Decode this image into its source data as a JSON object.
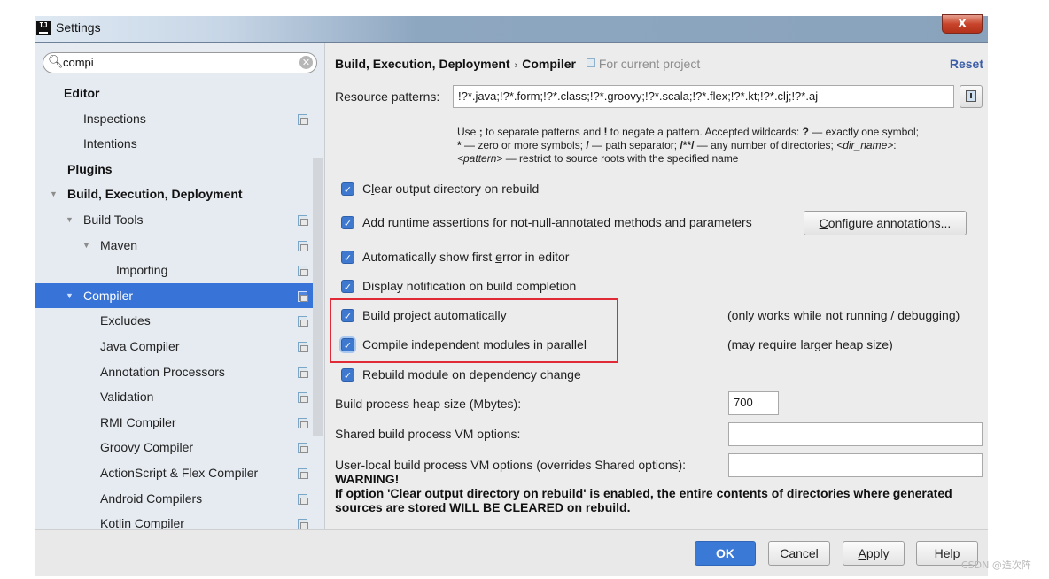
{
  "window": {
    "title": "Settings",
    "app_icon": "intellij-icon",
    "close_label": "x"
  },
  "search": {
    "value": "compi",
    "icon": "search-icon",
    "clear_icon": "clear-icon"
  },
  "tree": [
    {
      "label": "Editor",
      "bold": true,
      "level": 0,
      "arrow": false,
      "project_icon": false,
      "selected": false
    },
    {
      "label": "Inspections",
      "bold": false,
      "level": 1,
      "arrow": false,
      "project_icon": true,
      "selected": false
    },
    {
      "label": "Intentions",
      "bold": false,
      "level": 1,
      "arrow": false,
      "project_icon": false,
      "selected": false
    },
    {
      "label": "Plugins",
      "bold": true,
      "level": 0,
      "arrow": false,
      "project_icon": false,
      "selected": false
    },
    {
      "label": "Build, Execution, Deployment",
      "bold": true,
      "level": 0,
      "arrow": true,
      "project_icon": false,
      "selected": false
    },
    {
      "label": "Build Tools",
      "bold": false,
      "level": 1,
      "arrow": true,
      "project_icon": true,
      "selected": false
    },
    {
      "label": "Maven",
      "bold": false,
      "level": 2,
      "arrow": true,
      "project_icon": true,
      "selected": false
    },
    {
      "label": "Importing",
      "bold": false,
      "level": 3,
      "arrow": false,
      "project_icon": true,
      "selected": false
    },
    {
      "label": "Compiler",
      "bold": false,
      "level": 1,
      "arrow": true,
      "project_icon": true,
      "selected": true
    },
    {
      "label": "Excludes",
      "bold": false,
      "level": 2,
      "arrow": false,
      "project_icon": true,
      "selected": false
    },
    {
      "label": "Java Compiler",
      "bold": false,
      "level": 2,
      "arrow": false,
      "project_icon": true,
      "selected": false
    },
    {
      "label": "Annotation Processors",
      "bold": false,
      "level": 2,
      "arrow": false,
      "project_icon": true,
      "selected": false
    },
    {
      "label": "Validation",
      "bold": false,
      "level": 2,
      "arrow": false,
      "project_icon": true,
      "selected": false
    },
    {
      "label": "RMI Compiler",
      "bold": false,
      "level": 2,
      "arrow": false,
      "project_icon": true,
      "selected": false
    },
    {
      "label": "Groovy Compiler",
      "bold": false,
      "level": 2,
      "arrow": false,
      "project_icon": true,
      "selected": false
    },
    {
      "label": "ActionScript & Flex Compiler",
      "bold": false,
      "level": 2,
      "arrow": false,
      "project_icon": true,
      "selected": false
    },
    {
      "label": "Android Compilers",
      "bold": false,
      "level": 2,
      "arrow": false,
      "project_icon": true,
      "selected": false
    },
    {
      "label": "Kotlin Compiler",
      "bold": false,
      "level": 2,
      "arrow": false,
      "project_icon": true,
      "selected": false
    }
  ],
  "header": {
    "crumb_parent": "Build, Execution, Deployment",
    "crumb_separator": "›",
    "crumb_current": "Compiler",
    "scope_label": "For current project",
    "reset_label": "Reset"
  },
  "resource_patterns": {
    "label": "Resource patterns:",
    "value": "!?*.java;!?*.form;!?*.class;!?*.groovy;!?*.scala;!?*.flex;!?*.kt;!?*.clj;!?*.aj",
    "hint_line1_pre": "Use ",
    "hint_line1_b1": ";",
    "hint_line1_mid": " to separate patterns and ",
    "hint_line1_b2": "!",
    "hint_line1_mid2": " to negate a pattern. Accepted wildcards: ",
    "hint_line1_b3": "?",
    "hint_line1_post": " — exactly one symbol;",
    "hint_line2_b1": "*",
    "hint_line2_mid": " — zero or more symbols; ",
    "hint_line2_b2": "/",
    "hint_line2_mid2": " — path separator; ",
    "hint_line2_b3": "/**/",
    "hint_line2_mid3": " — any number of directories; ",
    "hint_line2_i": "<dir_name>",
    "hint_line2_post": ":",
    "hint_line3_i": "<pattern>",
    "hint_line3_post": " — restrict to source roots with the specified name"
  },
  "options": {
    "clear_output": {
      "pre": "C",
      "u": "l",
      "post": "ear output directory on rebuild",
      "checked": true
    },
    "runtime_assertions": {
      "pre": "Add runtime ",
      "u": "a",
      "post": "ssertions for not-null-annotated methods and parameters",
      "checked": true
    },
    "configure_annotations": {
      "u": "C",
      "post": "onfigure annotations..."
    },
    "show_first_error": {
      "pre": "Automatically show first ",
      "u": "e",
      "post": "rror in editor",
      "checked": true
    },
    "display_notification": {
      "label": "Display notification on build completion",
      "checked": true
    },
    "build_automatically": {
      "label": "Build project automatically",
      "checked": true,
      "note": "(only works while not running / debugging)"
    },
    "compile_parallel": {
      "label": "Compile independent modules in parallel",
      "checked": true,
      "note": "(may require larger heap size)"
    },
    "rebuild_on_dependency": {
      "label": "Rebuild module on dependency change",
      "checked": true
    }
  },
  "fields": {
    "heap_size": {
      "label": "Build process heap size (Mbytes):",
      "value": "700"
    },
    "shared_vm": {
      "label": "Shared build process VM options:",
      "value": ""
    },
    "user_vm": {
      "label": "User-local build process VM options (overrides Shared options):",
      "value": ""
    }
  },
  "warning": {
    "title": "WARNING!",
    "body": "If option 'Clear output directory on rebuild' is enabled, the entire contents of directories where generated sources are stored WILL BE CLEARED on rebuild."
  },
  "footer": {
    "ok": "OK",
    "cancel": "Cancel",
    "apply_u": "A",
    "apply_post": "pply",
    "help": "Help"
  },
  "watermark": "CSDN @造次阵",
  "colors": {
    "accent": "#3b79d6",
    "selection": "#3874d8",
    "highlight_box": "#e02b36",
    "reset_link": "#3c5ea8"
  }
}
